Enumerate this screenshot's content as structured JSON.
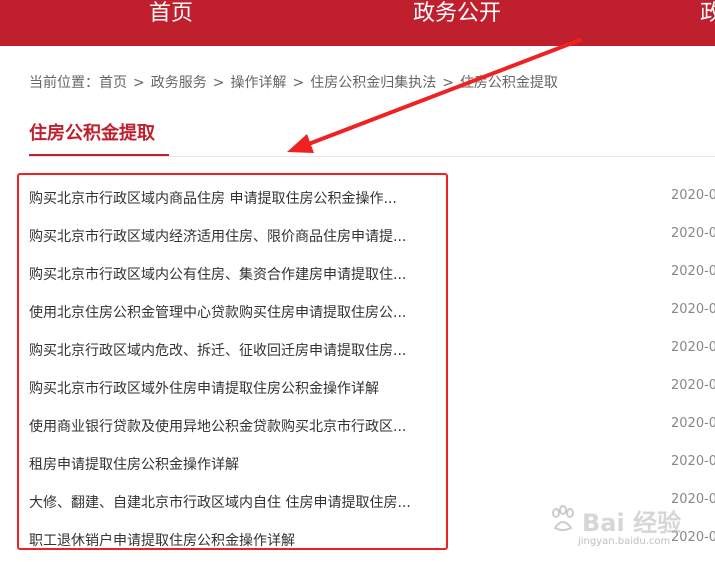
{
  "nav": {
    "items": [
      {
        "label": "首页"
      },
      {
        "label": "政务公开"
      },
      {
        "label": "政"
      }
    ]
  },
  "breadcrumb": {
    "prefix": "当前位置：",
    "items": [
      "首页",
      "政务服务",
      "操作详解",
      "住房公积金归集执法",
      "住房公积金提取"
    ],
    "separator": ">"
  },
  "section": {
    "title": "住房公积金提取"
  },
  "list": {
    "items": [
      {
        "title": "购买北京市行政区域内商品住房 申请提取住房公积金操作...",
        "date": "2020-0"
      },
      {
        "title": "购买北京市行政区域内经济适用住房、限价商品住房申请提...",
        "date": "2020-0"
      },
      {
        "title": "购买北京市行政区域内公有住房、集资合作建房申请提取住...",
        "date": "2020-0"
      },
      {
        "title": "使用北京住房公积金管理中心贷款购买住房申请提取住房公...",
        "date": "2020-0"
      },
      {
        "title": "购买北京行政区域内危改、拆迁、征收回迁房申请提取住房...",
        "date": "2020-0"
      },
      {
        "title": "购买北京市行政区域外住房申请提取住房公积金操作详解",
        "date": "2020-0"
      },
      {
        "title": "使用商业银行贷款及使用异地公积金贷款购买北京市行政区...",
        "date": "2020-0"
      },
      {
        "title": "租房申请提取住房公积金操作详解",
        "date": "2020-0"
      },
      {
        "title": "大修、翻建、自建北京市行政区域内自住 住房申请提取住房...",
        "date": "2020-0"
      },
      {
        "title": "职工退休销户申请提取住房公积金操作详解",
        "date": "2020-0"
      }
    ]
  },
  "annotation": {
    "color": "#ee2222"
  },
  "watermark": {
    "brand": "Bai 经验",
    "url": "jingyan.baidu.com"
  },
  "colors": {
    "brand_red": "#c01f2e",
    "text": "#333333",
    "muted": "#888888"
  }
}
